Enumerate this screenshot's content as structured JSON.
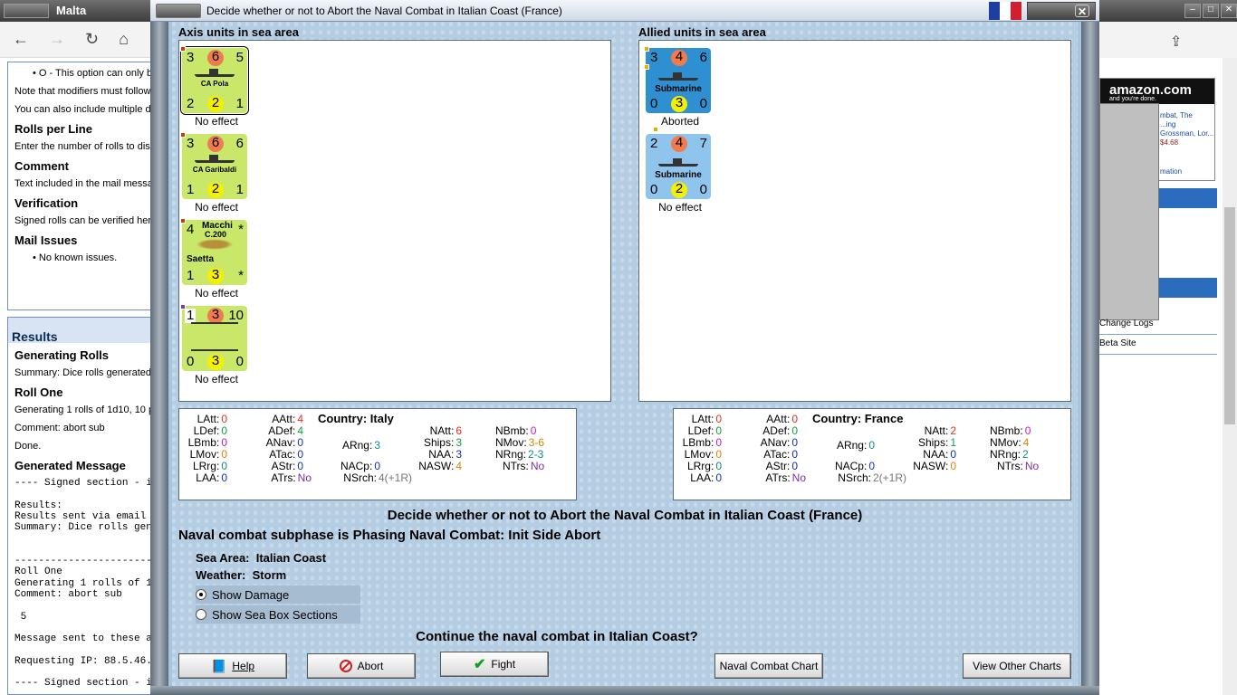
{
  "left_window": {
    "title": "Malta",
    "nav": {
      "back": "←",
      "forward": "→",
      "reload": "↻",
      "home": "⌂"
    },
    "panel1": {
      "bullet1": "O - This option can only b",
      "line1": "Note that modifiers must follow",
      "line2": "You can also include multiple d",
      "h_rolls": "Rolls per Line",
      "rolls_text": "Enter the number of rolls to disp",
      "h_comment": "Comment",
      "comment_text": "Text included in the mail messa",
      "h_verification": "Verification",
      "verification_text": "Signed rolls can be verified her",
      "h_mail": "Mail Issues",
      "mail_bullet": "No known issues."
    },
    "panel2": {
      "results": "Results",
      "h_generating": "Generating Rolls",
      "summary": "Summary: Dice rolls generated",
      "h_roll_one": "Roll One",
      "generating": "Generating 1 rolls of 1d10, 10 p",
      "comment": "Comment: abort sub",
      "done": "Done.",
      "h_generated_msg": "Generated Message",
      "mono": "---- Signed section - i\n\nResults:\nResults sent via email\nSummary: Dice rolls gen\n\n\n-----------------------\nRoll One\nGenerating 1 rolls of 1\nComment: abort sub\n\n 5\n\nMessage sent to these a\n\nRequesting IP: 88.5.46.\n\n---- Signed section - i"
    }
  },
  "right_window": {
    "amazon_logo": "amazon.com",
    "amazon_tag": "and you're done.",
    "ad_lines": [
      "mbat, The",
      "...ing",
      "Grossman, Lor...",
      "$4.68",
      "mation"
    ],
    "list": [
      "Change Logs",
      "Beta Site"
    ]
  },
  "dialog": {
    "title": "Decide whether or not to Abort the Naval Combat in Italian Coast (France)",
    "flag_colors": [
      "#1f3fa0",
      "#ffffff",
      "#d02030"
    ],
    "axis_title": "Axis units in sea area",
    "allied_title": "Allied units in sea area",
    "axis_units": [
      {
        "tl": "3",
        "tc": "6",
        "tr": "5",
        "bl": "2",
        "bc": "2",
        "br": "1",
        "name": "CA Pola",
        "status": "No effect"
      },
      {
        "tl": "3",
        "tc": "6",
        "tr": "6",
        "bl": "1",
        "bc": "2",
        "br": "1",
        "name": "CA Garibaldi",
        "status": "No effect"
      },
      {
        "tl": "4",
        "tr": "*",
        "bl": "1",
        "bc": "3",
        "br": "*",
        "name_top": "Macchi",
        "name_mid": "C.200",
        "name_bottom": "Saetta",
        "status": "No effect"
      },
      {
        "tl": "1",
        "tc": "3",
        "tr": "10",
        "bl": "0",
        "bc": "3",
        "br": "0",
        "status": "No effect"
      }
    ],
    "allied_units": [
      {
        "tl": "3",
        "tc": "4",
        "tr": "6",
        "bl": "0",
        "bc": "3",
        "br": "0",
        "name": "Submarine",
        "status": "Aborted"
      },
      {
        "tl": "2",
        "tc": "4",
        "tr": "7",
        "bl": "0",
        "bc": "2",
        "br": "0",
        "name": "Submarine",
        "status": "No effect"
      }
    ],
    "axis_stats": {
      "country_label": "Country:",
      "country": "Italy",
      "LAtt": "0",
      "LDef": "0",
      "LBmb": "0",
      "LMov": "0",
      "LRrg": "0",
      "LAA": "0",
      "AAtt": "4",
      "ADef": "4",
      "ANav": "0",
      "ATac": "0",
      "AStr": "0",
      "ATrs": "No",
      "ARng": "3",
      "NACp": "0",
      "NAtt": "6",
      "Ships": "3",
      "NAA": "3",
      "NASW": "4",
      "NSrch": "4(+1R)",
      "NBmb": "0",
      "NMov": "3-6",
      "NRng": "2-3",
      "NTrs": "No"
    },
    "allied_stats": {
      "country_label": "Country:",
      "country": "France",
      "LAtt": "0",
      "LDef": "0",
      "LBmb": "0",
      "LMov": "0",
      "LRrg": "0",
      "LAA": "0",
      "AAtt": "0",
      "ADef": "0",
      "ANav": "0",
      "ATac": "0",
      "AStr": "0",
      "ATrs": "No",
      "ARng": "0",
      "NACp": "0",
      "NAtt": "2",
      "Ships": "1",
      "NAA": "0",
      "NASW": "0",
      "NSrch": "2(+1R)",
      "NBmb": "0",
      "NMov": "4",
      "NRng": "2",
      "NTrs": "No"
    },
    "heading": "Decide whether or not to Abort the Naval Combat in Italian Coast (France)",
    "subphase": "Naval combat subphase is Phasing Naval Combat: Init Side Abort",
    "sea_area_label": "Sea Area:",
    "sea_area": "Italian Coast",
    "weather_label": "Weather:",
    "weather": "Storm",
    "radio_damage": "Show Damage",
    "radio_seabox": "Show Sea Box Sections",
    "question": "Continue the naval combat in Italian Coast?",
    "buttons": {
      "help": "Help",
      "abort": "Abort",
      "fight": "Fight",
      "naval_chart": "Naval Combat Chart",
      "other_charts": "View Other Charts"
    }
  }
}
